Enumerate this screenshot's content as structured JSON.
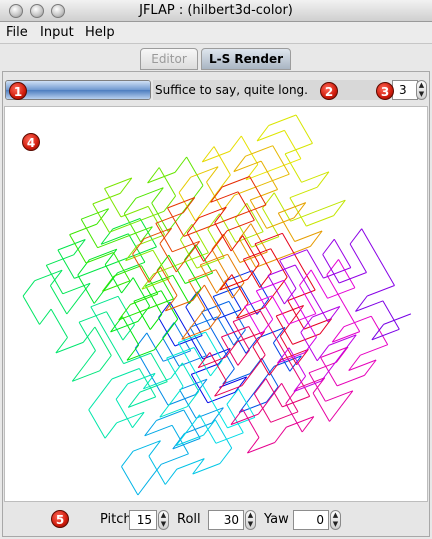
{
  "window": {
    "title": "JFLAP : (hilbert3d-color)"
  },
  "menu": {
    "items": [
      "File",
      "Input",
      "Help"
    ]
  },
  "tabs": [
    {
      "label": "Editor",
      "active": false
    },
    {
      "label": "L-S Render",
      "active": true
    }
  ],
  "toolbar": {
    "progress_fraction": 1.0,
    "status_text": "Suffice to say, quite long.",
    "iterations": "3"
  },
  "markers": [
    "1",
    "2",
    "3",
    "4",
    "5"
  ],
  "orientation": {
    "pitch_label": "Pitch",
    "pitch": "15",
    "roll_label": "Roll",
    "roll": "30",
    "yaw_label": "Yaw",
    "yaw": "0"
  },
  "colors": {
    "accent": "#d01c0c",
    "curve_spectrum": [
      "#0000cc",
      "#00ccff",
      "#00ff66",
      "#ccff00",
      "#ffcc00",
      "#ff3300",
      "#ff00cc",
      "#cc00ff"
    ]
  }
}
